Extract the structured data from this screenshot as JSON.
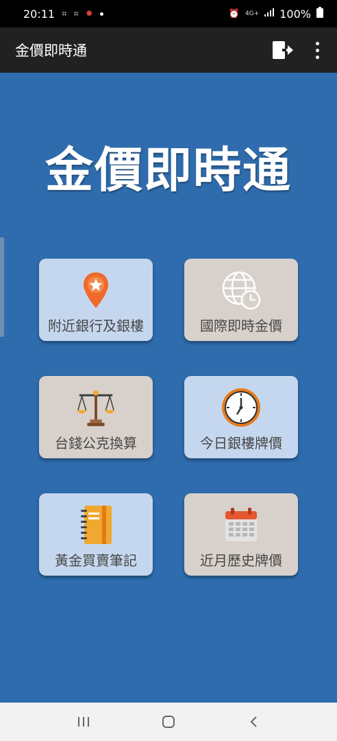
{
  "status_bar": {
    "time": "20:11",
    "network": "4G+",
    "battery": "100%"
  },
  "app_bar": {
    "title": "金價即時通"
  },
  "hero": {
    "title": "金價即時通"
  },
  "tiles": [
    {
      "label": "附近銀行及銀樓",
      "icon": "map-pin-star-icon"
    },
    {
      "label": "國際即時金價",
      "icon": "globe-clock-icon"
    },
    {
      "label": "台錢公克換算",
      "icon": "balance-scale-icon"
    },
    {
      "label": "今日銀樓牌價",
      "icon": "clock-icon"
    },
    {
      "label": "黃金買賣筆記",
      "icon": "notebook-icon"
    },
    {
      "label": "近月歷史牌價",
      "icon": "calendar-icon"
    }
  ],
  "colors": {
    "background": "#2e6cad",
    "app_bar": "#212121",
    "tile_blue": "#c5d7ee",
    "tile_gray": "#d8d1cb"
  }
}
